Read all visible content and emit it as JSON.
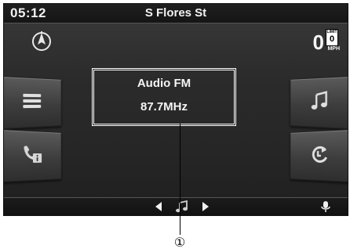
{
  "status_bar": {
    "time": "05:12",
    "street": "S Flores St"
  },
  "speed": {
    "value": "0",
    "limit_label": "LIMIT",
    "limit_value": "0",
    "unit": "MPH"
  },
  "audio": {
    "source": "Audio FM",
    "frequency": "87.7MHz"
  },
  "callout": {
    "number": "①"
  },
  "icons": {
    "compass": "compass-icon",
    "menu": "menu-icon",
    "phone_info": "phone-info-icon",
    "music": "music-note-icon",
    "sync": "sync-icon",
    "prev": "prev-arrow-icon",
    "note": "music-note-icon",
    "next": "next-arrow-icon",
    "mic": "microphone-icon"
  },
  "colors": {
    "screen_bg": "#2b2b2b",
    "text": "#f5f5f5",
    "button_top": "#5a5a5a",
    "button_bottom": "#2e2e2e"
  }
}
